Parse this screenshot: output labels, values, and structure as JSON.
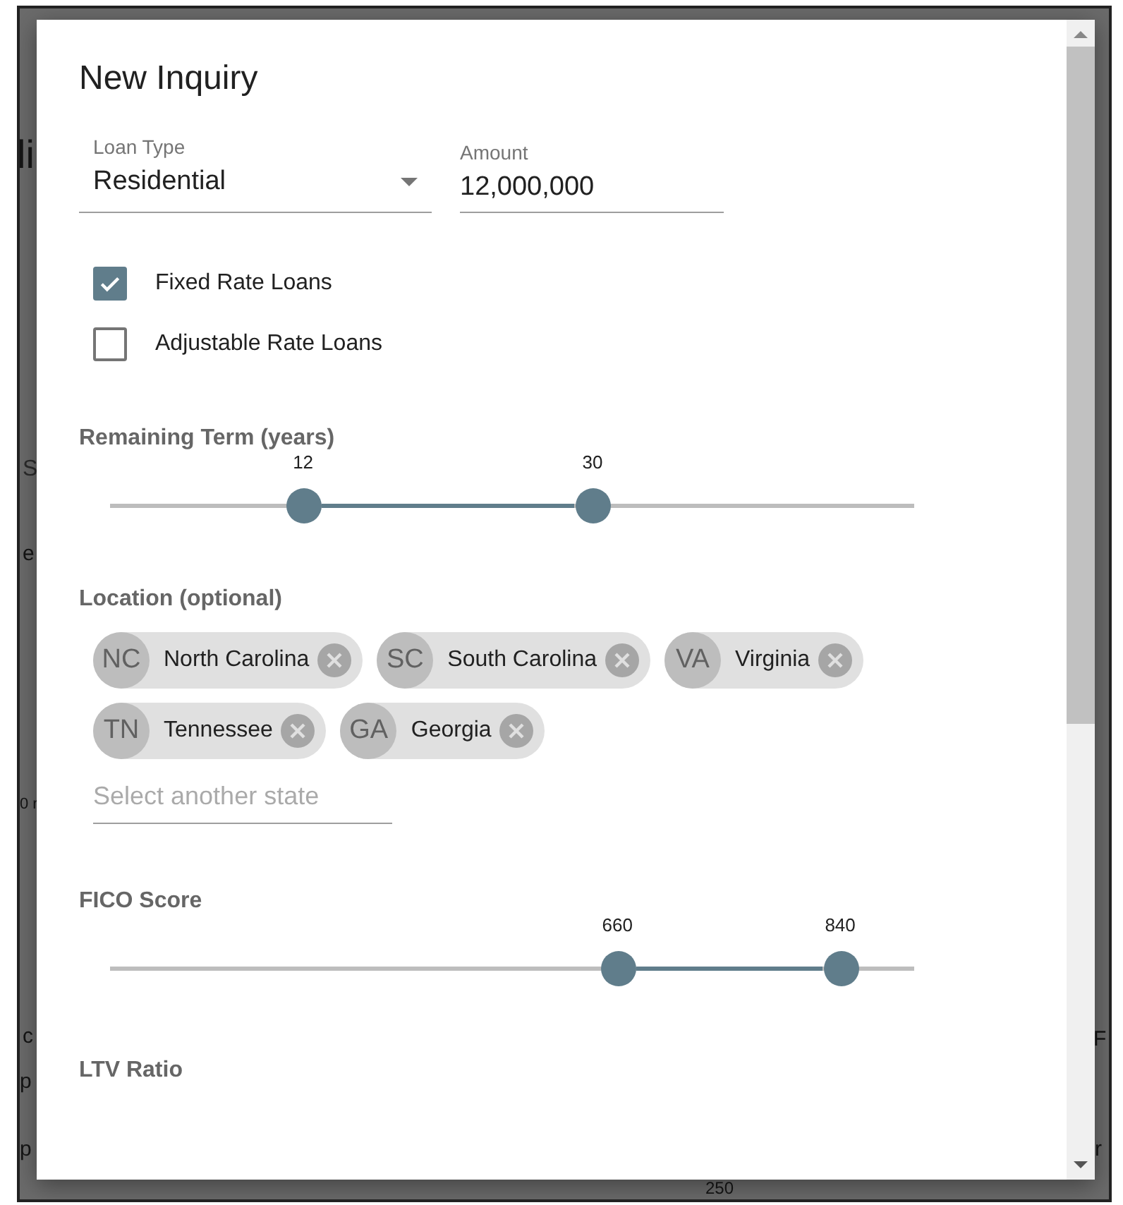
{
  "background": {
    "left_fragments": [
      "li",
      "S",
      "e",
      "0 r",
      "c",
      "p",
      "p"
    ],
    "right_fragments": [
      "F",
      "r"
    ],
    "bottom_fragment": "250"
  },
  "dialog": {
    "title": "New Inquiry",
    "loan_type": {
      "label": "Loan Type",
      "value": "Residential"
    },
    "amount": {
      "label": "Amount",
      "value": "12,000,000"
    },
    "checkboxes": [
      {
        "label": "Fixed Rate Loans",
        "checked": true
      },
      {
        "label": "Adjustable Rate Loans",
        "checked": false
      }
    ],
    "term": {
      "label": "Remaining Term (years)",
      "thumbs": [
        {
          "value": "12",
          "level": 0.24
        },
        {
          "value": "30",
          "level": 0.6
        }
      ]
    },
    "location": {
      "label": "Location (optional)",
      "chips": [
        {
          "abbr": "NC",
          "name": "North Carolina"
        },
        {
          "abbr": "SC",
          "name": "South Carolina"
        },
        {
          "abbr": "VA",
          "name": "Virginia"
        },
        {
          "abbr": "TN",
          "name": "Tennessee"
        },
        {
          "abbr": "GA",
          "name": "Georgia"
        }
      ],
      "placeholder": "Select another state"
    },
    "fico": {
      "label": "FICO Score",
      "thumbs": [
        {
          "value": "660",
          "level": 0.631
        },
        {
          "value": "840",
          "level": 0.908
        }
      ]
    },
    "ltv_label": "LTV Ratio"
  }
}
